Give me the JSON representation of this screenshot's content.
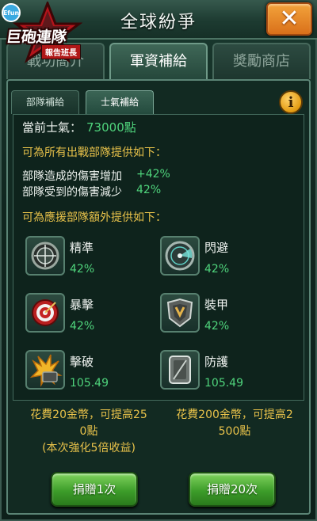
{
  "header": {
    "title": "全球紛爭",
    "close_label": "✕"
  },
  "logo": {
    "brand": "巨砲連隊",
    "subtitle": "報告班長",
    "badge": "Efun"
  },
  "tabs": [
    {
      "label": "戰功簡介",
      "active": false
    },
    {
      "label": "軍資補給",
      "active": true
    },
    {
      "label": "獎勵商店",
      "active": false
    }
  ],
  "subtabs": [
    {
      "label": "部隊補給",
      "active": false
    },
    {
      "label": "士氣補給",
      "active": true
    }
  ],
  "info_label": "i",
  "morale": {
    "label": "當前士氣：",
    "value": "73000點"
  },
  "section1": {
    "heading": "可為所有出戰部隊提供如下：",
    "line1_label": "部隊造成的傷害增加",
    "line1_value": "+42%",
    "line2_label": "部隊受到的傷害減少",
    "line2_value": "42%"
  },
  "section2": {
    "heading": "可為應援部隊額外提供如下："
  },
  "stats": [
    {
      "name": "精準",
      "value": "42%",
      "icon": "scope-icon"
    },
    {
      "name": "閃避",
      "value": "42%",
      "icon": "radar-icon"
    },
    {
      "name": "暴擊",
      "value": "42%",
      "icon": "target-icon"
    },
    {
      "name": "裝甲",
      "value": "42%",
      "icon": "armor-icon"
    },
    {
      "name": "擊破",
      "value": "105.49",
      "icon": "explosion-icon"
    },
    {
      "name": "防護",
      "value": "105.49",
      "icon": "shield-icon"
    }
  ],
  "cost_left": {
    "line1": "花費20金幣，可提高25",
    "line2": "0點",
    "line3": "(本次強化5倍收益)"
  },
  "cost_right": {
    "line1": "花費200金幣，可提高2",
    "line2": "500點"
  },
  "buttons": {
    "donate_once": "捐贈1次",
    "donate_twenty": "捐贈20次"
  },
  "colors": {
    "accent_gold": "#e8c24a",
    "value_green": "#4fd47c",
    "button_green": "#3d9d2a",
    "close_orange": "#e38420"
  }
}
